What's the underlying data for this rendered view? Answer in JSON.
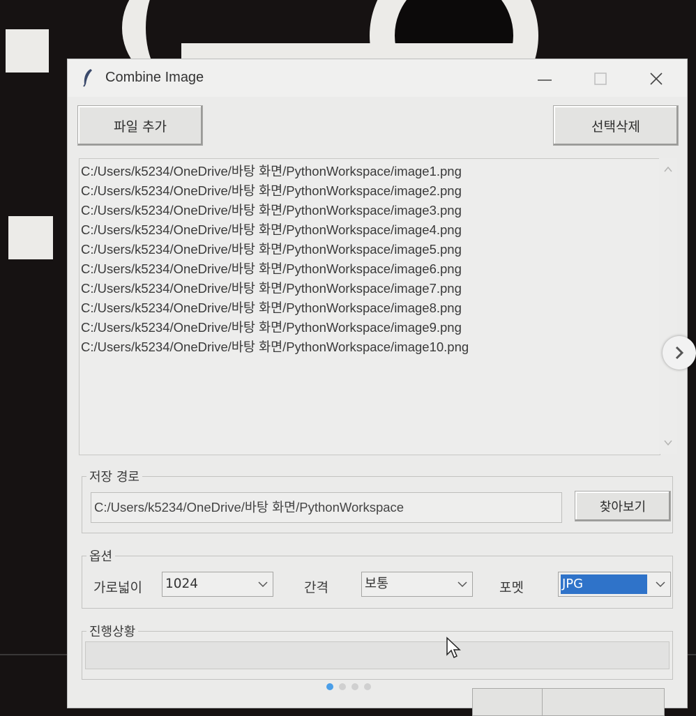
{
  "window": {
    "title": "Combine Image",
    "controls": [
      "minimize",
      "maximize",
      "close"
    ]
  },
  "toolbar": {
    "add_label": "파일 추가",
    "delete_label": "선택삭제"
  },
  "file_list": {
    "items": [
      "C:/Users/k5234/OneDrive/바탕 화면/PythonWorkspace/image1.png",
      "C:/Users/k5234/OneDrive/바탕 화면/PythonWorkspace/image2.png",
      "C:/Users/k5234/OneDrive/바탕 화면/PythonWorkspace/image3.png",
      "C:/Users/k5234/OneDrive/바탕 화면/PythonWorkspace/image4.png",
      "C:/Users/k5234/OneDrive/바탕 화면/PythonWorkspace/image5.png",
      "C:/Users/k5234/OneDrive/바탕 화면/PythonWorkspace/image6.png",
      "C:/Users/k5234/OneDrive/바탕 화면/PythonWorkspace/image7.png",
      "C:/Users/k5234/OneDrive/바탕 화면/PythonWorkspace/image8.png",
      "C:/Users/k5234/OneDrive/바탕 화면/PythonWorkspace/image9.png",
      "C:/Users/k5234/OneDrive/바탕 화면/PythonWorkspace/image10.png"
    ]
  },
  "save_path": {
    "group_label": "저장 경로",
    "value": "C:/Users/k5234/OneDrive/바탕 화면/PythonWorkspace",
    "browse_label": "찾아보기"
  },
  "options": {
    "group_label": "옵션",
    "width_label": "가로넓이",
    "width_value": "1024",
    "gap_label": "간격",
    "gap_value": "보통",
    "format_label": "포멧",
    "format_value": "JPG"
  },
  "progress": {
    "group_label": "진행상황",
    "value": 0
  },
  "icons": {
    "title": "feather-icon",
    "minimize": "minimize-icon",
    "maximize": "maximize-icon",
    "close": "close-icon",
    "dropdown": "chevron-down-icon",
    "next": "chevron-right-icon",
    "cursor": "mouse-pointer-icon"
  },
  "colors": {
    "selection": "#2f73c9",
    "window_bg": "#ebebea"
  }
}
